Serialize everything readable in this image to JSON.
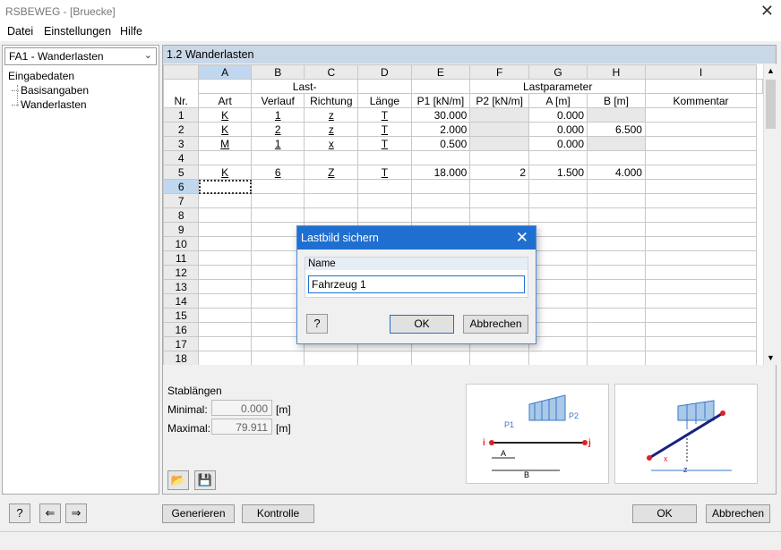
{
  "window": {
    "title": "RSBEWEG - [Bruecke]"
  },
  "menu": [
    "Datei",
    "Einstellungen",
    "Hilfe"
  ],
  "left": {
    "case": "FA1 - Wanderlasten",
    "tree_root": "Eingabedaten",
    "tree_items": [
      "Basisangaben",
      "Wanderlasten"
    ]
  },
  "section_title": "1.2 Wanderlasten",
  "table": {
    "col_letters": [
      "A",
      "B",
      "C",
      "D",
      "E",
      "F",
      "G",
      "H",
      "I"
    ],
    "group_last": "Last-",
    "group_params": "Lastparameter",
    "row_header": "Nr.",
    "col_headers": [
      "Art",
      "Verlauf",
      "Richtung",
      "Länge",
      "P1 [kN/m]",
      "P2 [kN/m]",
      "A [m]",
      "B [m]",
      "Kommentar"
    ],
    "rows": [
      {
        "nr": "1",
        "cells": [
          "K",
          "1",
          "z",
          "T",
          "30.000",
          "",
          "0.000",
          "",
          ""
        ]
      },
      {
        "nr": "2",
        "cells": [
          "K",
          "2",
          "z",
          "T",
          "2.000",
          "",
          "0.000",
          "6.500",
          ""
        ]
      },
      {
        "nr": "3",
        "cells": [
          "M",
          "1",
          "x",
          "T",
          "0.500",
          "",
          "0.000",
          "",
          ""
        ]
      },
      {
        "nr": "4",
        "cells": [
          "",
          "",
          "",
          "",
          "",
          "",
          "",
          "",
          ""
        ]
      },
      {
        "nr": "5",
        "cells": [
          "K",
          "6",
          "Z",
          "T",
          "18.000",
          "2",
          "1.500",
          "4.000",
          ""
        ]
      },
      {
        "nr": "6",
        "cells": [
          "",
          "",
          "",
          "",
          "",
          "",
          "",
          "",
          ""
        ]
      },
      {
        "nr": "7",
        "cells": [
          "",
          "",
          "",
          "",
          "",
          "",
          "",
          "",
          ""
        ]
      },
      {
        "nr": "8",
        "cells": [
          "",
          "",
          "",
          "",
          "",
          "",
          "",
          "",
          ""
        ]
      },
      {
        "nr": "9",
        "cells": [
          "",
          "",
          "",
          "",
          "",
          "",
          "",
          "",
          ""
        ]
      },
      {
        "nr": "10",
        "cells": [
          "",
          "",
          "",
          "",
          "",
          "",
          "",
          "",
          ""
        ]
      },
      {
        "nr": "11",
        "cells": [
          "",
          "",
          "",
          "",
          "",
          "",
          "",
          "",
          ""
        ]
      },
      {
        "nr": "12",
        "cells": [
          "",
          "",
          "",
          "",
          "",
          "",
          "",
          "",
          ""
        ]
      },
      {
        "nr": "13",
        "cells": [
          "",
          "",
          "",
          "",
          "",
          "",
          "",
          "",
          ""
        ]
      },
      {
        "nr": "14",
        "cells": [
          "",
          "",
          "",
          "",
          "",
          "",
          "",
          "",
          ""
        ]
      },
      {
        "nr": "15",
        "cells": [
          "",
          "",
          "",
          "",
          "",
          "",
          "",
          "",
          ""
        ]
      },
      {
        "nr": "16",
        "cells": [
          "",
          "",
          "",
          "",
          "",
          "",
          "",
          "",
          ""
        ]
      },
      {
        "nr": "17",
        "cells": [
          "",
          "",
          "",
          "",
          "",
          "",
          "",
          "",
          ""
        ]
      },
      {
        "nr": "18",
        "cells": [
          "",
          "",
          "",
          "",
          "",
          "",
          "",
          "",
          ""
        ]
      }
    ]
  },
  "stab": {
    "title": "Stablängen",
    "min_label": "Minimal:",
    "min_value": "0.000",
    "max_label": "Maximal:",
    "max_value": "79.911",
    "unit": "[m]"
  },
  "diagram1": {
    "p1": "P1",
    "p2": "P2",
    "i": "i",
    "j": "j",
    "a": "A",
    "b": "B"
  },
  "diagram2": {
    "x": "x",
    "z": "z"
  },
  "dialog": {
    "title": "Lastbild sichern",
    "group_label": "Name",
    "name_value": "Fahrzeug 1",
    "ok": "OK",
    "cancel": "Abbrechen"
  },
  "bottom": {
    "generieren": "Generieren",
    "kontrolle": "Kontrolle",
    "ok": "OK",
    "abbrechen": "Abbrechen"
  },
  "colors": {
    "accent": "#1f6fd0",
    "section_head": "#c9d7e6",
    "selected": "#c0d7ef"
  }
}
